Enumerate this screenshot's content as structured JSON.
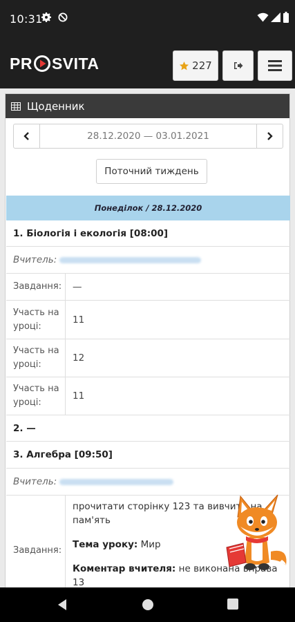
{
  "status_bar": {
    "time": "10:31"
  },
  "app": {
    "logo_left": "PR",
    "logo_right": "SVITA",
    "stars_count": "227",
    "colors": {
      "header_bg": "#1f1f1f",
      "star": "#e8a317",
      "logo_play": "#e53935",
      "day_header": "#a9d4ec"
    }
  },
  "panel": {
    "title": "Щоденник",
    "week_range": "28.12.2020 — 03.01.2021",
    "current_week_label": "Поточний тиждень",
    "day_header": "Понеділок / 28.12.2020"
  },
  "lessons": [
    {
      "title": "1. Біологія і екологія [08:00]",
      "teacher_label": "Вчитель:",
      "rows": [
        {
          "label": "Завдання:",
          "value": "—"
        },
        {
          "label": "Участь на уроці:",
          "value": "11"
        },
        {
          "label": "Участь на уроці:",
          "value": "12"
        },
        {
          "label": "Участь на уроці:",
          "value": "11"
        }
      ]
    },
    {
      "title": "2. —"
    },
    {
      "title": "3. Алгебра [09:50]",
      "teacher_label": "Вчитель:",
      "task_label": "Завдання:",
      "task_text": "прочитати сторінку 123 та вивчити на пам'ять",
      "topic_label": "Тема уроку:",
      "topic_value": "Мир",
      "comment_label": "Коментар вчителя:",
      "comment_value": "не виконана вправа 13"
    }
  ]
}
